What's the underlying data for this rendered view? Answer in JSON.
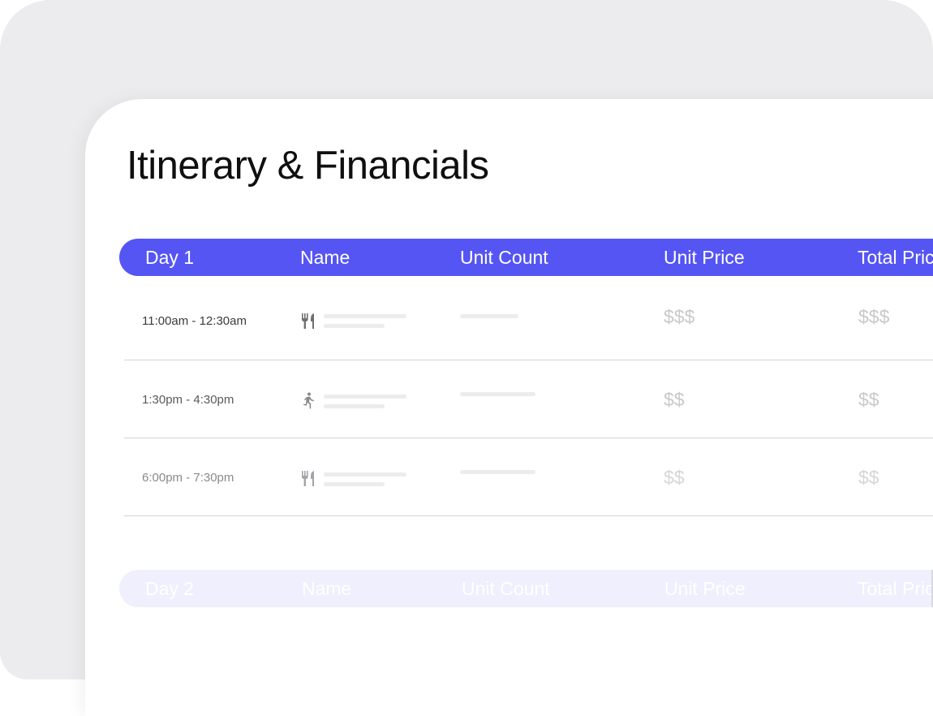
{
  "title": "Itinerary & Financials",
  "columns": {
    "day": "Day 1",
    "name": "Name",
    "unit_count": "Unit Count",
    "unit_price": "Unit Price",
    "total_price": "Total Price"
  },
  "rows": [
    {
      "time": "11:00am - 12:30am",
      "icon": "restaurant-icon",
      "unit_price": "$$$",
      "total_price": "$$$"
    },
    {
      "time": "1:30pm - 4:30pm",
      "icon": "activity-icon",
      "unit_price": "$$",
      "total_price": "$$"
    },
    {
      "time": "6:00pm - 7:30pm",
      "icon": "restaurant-icon",
      "unit_price": "$$",
      "total_price": "$$"
    }
  ],
  "next_section": {
    "day": "Day 2",
    "name": "Name",
    "unit_count": "Unit Count",
    "unit_price": "Unit Price",
    "total_price": "Total Price"
  },
  "colors": {
    "accent": "#5555f4",
    "accent_faded": "#efeffd",
    "background": "#ececee"
  }
}
